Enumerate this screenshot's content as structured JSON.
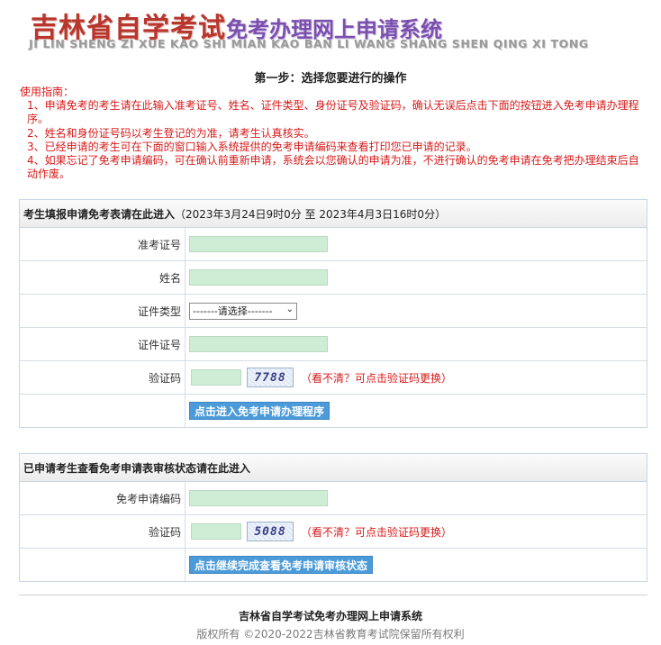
{
  "header": {
    "title_main": "吉林省自学考试",
    "title_sub": "免考办理网上申请系统",
    "pinyin": "JI LIN SHENG ZI XUE KAO SHI MIAN KAO BAN LI WANG SHANG SHEN QING XI TONG"
  },
  "step_title": "第一步：选择您要进行的操作",
  "guide": {
    "heading": "使用指南：",
    "items": [
      "1、申请免考的考生请在此输入准考证号、姓名、证件类型、身份证号及验证码，确认无误后点击下面的按钮进入免考申请办理程序。",
      "2、姓名和身份证号码以考生登记的为准，请考生认真核实。",
      "3、已经申请的考生可在下面的窗口输入系统提供的免考申请编码来查看打印您已申请的记录。",
      "4、如果忘记了免考申请编码，可在确认前重新申请，系统会以您确认的申请为准，不进行确认的免考申请在免考把办理结束后自动作废。"
    ]
  },
  "apply_panel": {
    "heading": "考生填报申请免考表请在此进入",
    "period": "（2023年3月24日9时0分 至 2023年4月3日16时0分）",
    "labels": {
      "exam_no": "准考证号",
      "name": "姓名",
      "id_type": "证件类型",
      "id_no": "证件证号",
      "captcha": "验证码"
    },
    "id_type_selected": "-------请选择-------",
    "captcha_code": "7788",
    "refresh_text": "（看不清？可点击验证码更换）",
    "submit_label": "点击进入免考申请办理程序"
  },
  "status_panel": {
    "heading": "已申请考生查看免考申请表审核状态请在此进入",
    "labels": {
      "app_code": "免考申请编码",
      "captcha": "验证码"
    },
    "captcha_code": "5088",
    "refresh_text": "（看不清？可点击验证码更换）",
    "submit_label": "点击继续完成查看免考申请审核状态"
  },
  "footer": {
    "title": "吉林省自学考试免考办理网上申请系统",
    "copyright": "版权所有 ©2020-2022吉林省教育考试院保留所有权利"
  }
}
